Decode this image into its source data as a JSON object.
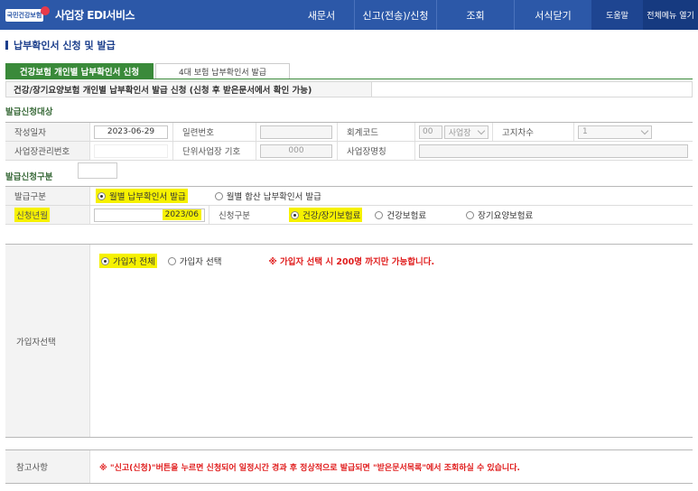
{
  "header": {
    "logo_text": "국민건강보험",
    "title": "사업장 EDI서비스",
    "nav": [
      "새문서",
      "신고(전송)/신청",
      "조회",
      "서식닫기"
    ],
    "help": "도움말",
    "all_menu": "전체메뉴 열기"
  },
  "page": {
    "title": "납부확인서 신청 및 발급"
  },
  "tabs": {
    "active": "건강보험 개인별 납부확인서 신청",
    "inactive": "4대 보험 납부확인서 발급"
  },
  "notice": "건강/장기요양보험 개인별 납부확인서 발급 신청 (신청 후 받은문서에서 확인 가능)",
  "target": {
    "section_title": "발급신청대상",
    "write_date_label": "작성일자",
    "write_date": "2023-06-29",
    "serial_label": "일련번호",
    "serial": "",
    "account_label": "회계코드",
    "account_code": "00",
    "account_name": "사업장",
    "notice_no_label": "고지차수",
    "notice_no": "1",
    "biz_no_label": "사업장관리번호",
    "biz_no": "",
    "unit_label": "단위사업장 기호",
    "unit": "000",
    "biz_name_label": "사업장명칭",
    "biz_name": ""
  },
  "type": {
    "section_title": "발급신청구분",
    "issue_type_label": "발급구분",
    "issue_monthly": "월별 납부확인서 발급",
    "issue_total": "월별 합산 납부확인서 발급",
    "period_label": "신청년월",
    "period": "2023/06",
    "apply_type_label": "신청구분",
    "apply_both": "건강/장기보험료",
    "apply_health": "건강보험료",
    "apply_ltc": "장기요양보험료"
  },
  "members": {
    "label": "가입자선택",
    "all": "가입자 전체",
    "select": "가입자 선택",
    "warning": "※ 가입자 선택 시 200명 까지만 가능합니다."
  },
  "reference": {
    "label": "참고사항",
    "text": "※ \"신고(신청)\"버튼을 누르면 신청되어 일정시간 경과 후 정상적으로 발급되면 \"받은문서목록\"에서 조회하실 수 있습니다."
  },
  "colors": {
    "header_bg": "#2c58a8",
    "tab_active": "#3a8a3a",
    "highlight": "#f6f100",
    "warning": "#e01d1d"
  }
}
